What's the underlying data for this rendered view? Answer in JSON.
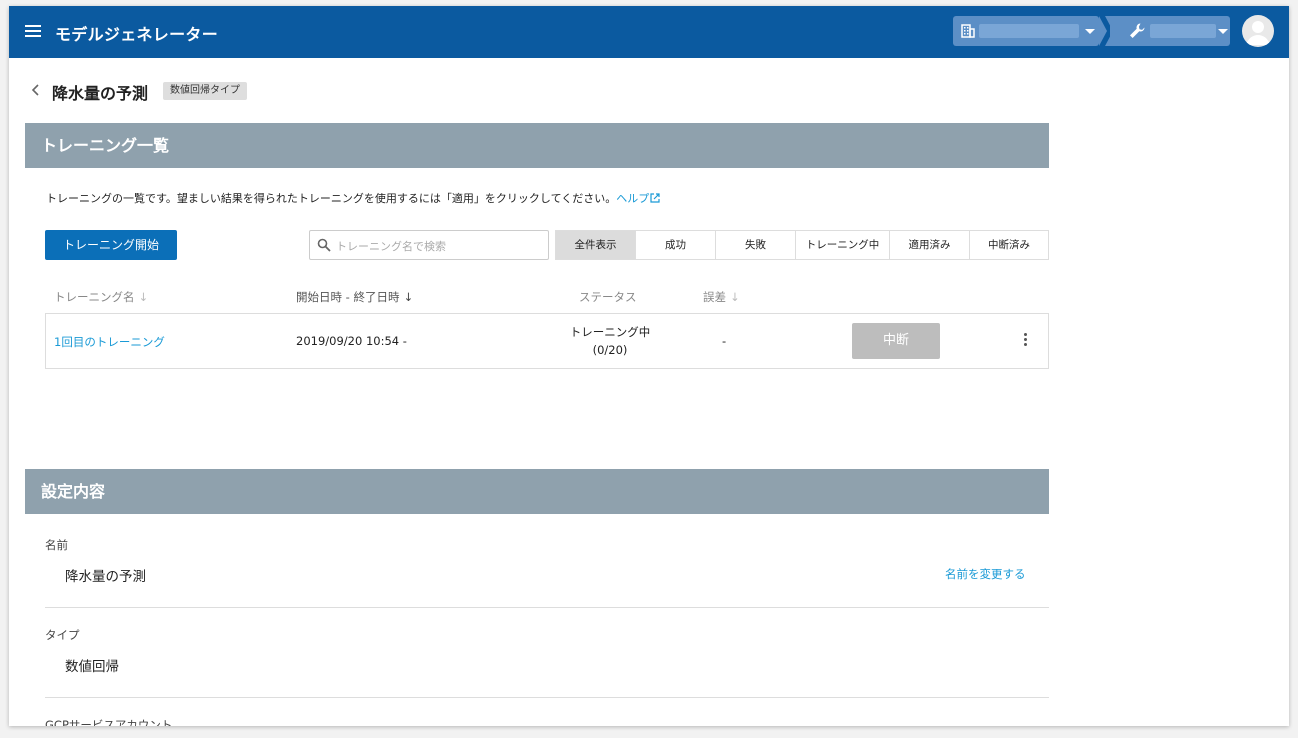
{
  "header": {
    "app_title": "モデルジェネレーター",
    "menu_icon": "hamburger-menu-icon",
    "org_icon": "building-icon",
    "project_icon": "wrench-icon",
    "avatar_icon": "user-avatar-icon"
  },
  "page": {
    "title": "降水量の予測",
    "type_badge": "数値回帰タイプ"
  },
  "training_section": {
    "header": "トレーニング一覧",
    "description": "トレーニングの一覧です。望ましい結果を得られたトレーニングを使用するには「適用」をクリックしてください。",
    "help_link": "ヘルプ",
    "start_button": "トレーニング開始",
    "search_placeholder": "トレーニング名で検索",
    "filters": [
      "全件表示",
      "成功",
      "失敗",
      "トレーニング中",
      "適用済み",
      "中断済み"
    ],
    "active_filter": "全件表示",
    "columns": {
      "name": "トレーニング名",
      "period": "開始日時 - 終了日時",
      "status": "ステータス",
      "error": "誤差"
    },
    "rows": [
      {
        "name": "1回目のトレーニング",
        "period": "2019/09/20 10:54 -",
        "status": "トレーニング中",
        "progress": "(0/20)",
        "error": "-",
        "action": "中断"
      }
    ]
  },
  "settings_section": {
    "header": "設定内容",
    "name_label": "名前",
    "name_value": "降水量の予測",
    "rename_link": "名前を変更する",
    "type_label": "タイプ",
    "type_value": "数値回帰",
    "gcp_label": "GCPサービスアカウント"
  },
  "colors": {
    "appbar": "#0b5aa0",
    "section_header": "#8fa1ad",
    "primary_button": "#0b6fb8",
    "link": "#1a9ad6"
  }
}
